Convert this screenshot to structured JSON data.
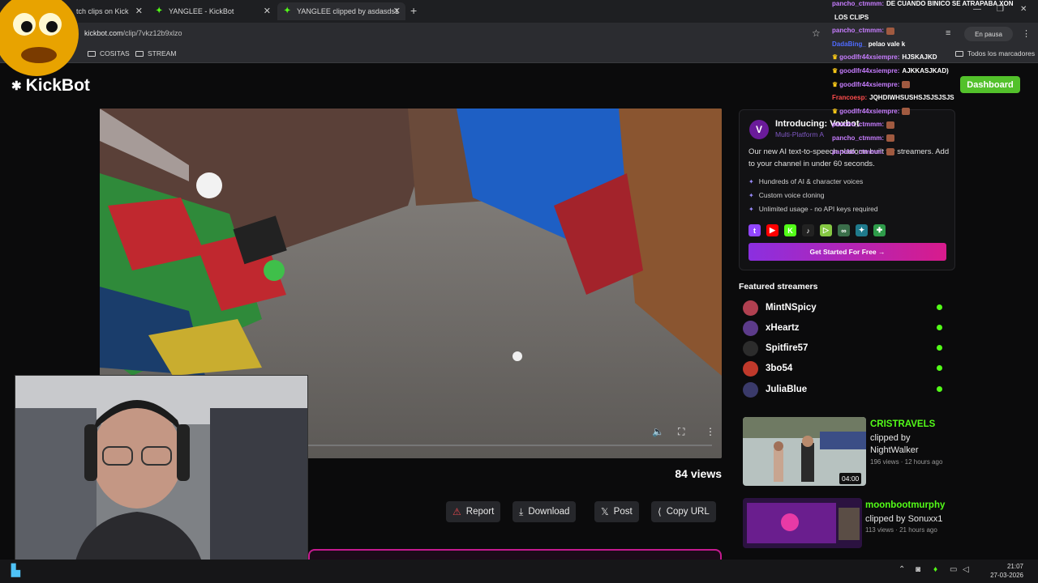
{
  "browser": {
    "tabs": [
      {
        "label": "tch clips on Kick"
      },
      {
        "label": "YANGLEE - KickBot"
      },
      {
        "label": "YANGLEE clipped by asdasds1"
      }
    ],
    "new_tab": "+",
    "url_host": "kickbot.com",
    "url_path": "/clip/7vkz12b9xlzo",
    "bookmarks": [
      "COSITAS",
      "STREAM"
    ],
    "bookmarks_right": "Todos los marcadores",
    "pause_label": "En pausa"
  },
  "header": {
    "logo_text": "KickBot",
    "dashboard_label": "Dashboard"
  },
  "clip": {
    "views": "84 views",
    "actions": {
      "report": "Report",
      "download": "Download",
      "post": "Post",
      "copy_url": "Copy URL"
    }
  },
  "ad": {
    "logo_letter": "V",
    "title": "Introducing: Voxbot",
    "subtitle": "Multi-Platform A",
    "description": "Our new AI text-to-speech platform built for streamers. Add to your channel in under 60 seconds.",
    "features": [
      "Hundreds of AI & character voices",
      "Custom voice cloning",
      "Unlimited usage - no API keys required"
    ],
    "platforms": [
      {
        "name": "twitch-icon",
        "glyph": "t",
        "color": "#9146ff"
      },
      {
        "name": "youtube-icon",
        "glyph": "▶",
        "color": "#ff0000"
      },
      {
        "name": "kick-icon",
        "glyph": "K",
        "color": "#53fc18"
      },
      {
        "name": "tiktok-icon",
        "glyph": "♪",
        "color": "#222222"
      },
      {
        "name": "rumble-icon",
        "glyph": "▷",
        "color": "#85c742"
      },
      {
        "name": "link-icon",
        "glyph": "∞",
        "color": "#3a6e4a"
      },
      {
        "name": "streamelements-icon",
        "glyph": "✦",
        "color": "#1f7a8c"
      },
      {
        "name": "puzzle-icon",
        "glyph": "✚",
        "color": "#2e9b4a"
      }
    ],
    "cta": "Get Started For Free →"
  },
  "featured": {
    "title": "Featured streamers",
    "streamers": [
      {
        "name": "MintNSpicy",
        "avatar_color": "#b04050"
      },
      {
        "name": "xHeartz",
        "avatar_color": "#5c3b8a"
      },
      {
        "name": "Spitfire57",
        "avatar_color": "#2c2c2c"
      },
      {
        "name": "3bo54",
        "avatar_color": "#c0392b"
      },
      {
        "name": "JuliaBlue",
        "avatar_color": "#3a3a6a"
      }
    ]
  },
  "clips": [
    {
      "channel": "CRISTRAVELS",
      "by": "clipped by NightWalker",
      "meta": "196 views · 12 hours ago",
      "duration": "04:00"
    },
    {
      "channel": "moonbootmurphy",
      "by": "clipped by Sonuxx1",
      "meta": "113 views · 21 hours ago",
      "duration": ""
    }
  ],
  "chat": [
    {
      "user": "pancho_ctmmm:",
      "user_color": "#c77dff",
      "msg": "DE CUANDO BINICO SE ATRAPABA XON",
      "crown": false,
      "emote": false
    },
    {
      "user": "",
      "user_color": "#ffffff",
      "msg": "LOS CLIPS",
      "crown": false,
      "emote": false
    },
    {
      "user": "pancho_ctmmm:",
      "user_color": "#c77dff",
      "msg": "",
      "crown": false,
      "emote": true
    },
    {
      "user": "DadaBing_",
      "user_color": "#4f6bff",
      "msg": "pelao vale k",
      "crown": false,
      "emote": false
    },
    {
      "user": "goodlfr44xsiempre:",
      "user_color": "#c77dff",
      "msg": "HJSKAJKD",
      "crown": true,
      "emote": false
    },
    {
      "user": "goodlfr44xsiempre:",
      "user_color": "#c77dff",
      "msg": "AJKKASJKAD)",
      "crown": true,
      "emote": false
    },
    {
      "user": "goodlfr44xsiempre:",
      "user_color": "#c77dff",
      "msg": "",
      "crown": true,
      "emote": true
    },
    {
      "user": "Francoesp:",
      "user_color": "#ff4d4d",
      "msg": "JQHDIWHSUSHSJSJSJSJS",
      "crown": false,
      "emote": false
    },
    {
      "user": "goodlfr44xsiempre:",
      "user_color": "#c77dff",
      "msg": "",
      "crown": true,
      "emote": true
    },
    {
      "user": "pancho_ctmmm:",
      "user_color": "#c77dff",
      "msg": "",
      "crown": false,
      "emote": true
    },
    {
      "user": "pancho_ctmmm:",
      "user_color": "#c77dff",
      "msg": "",
      "crown": false,
      "emote": true
    },
    {
      "user": "pancho_ctmmm:",
      "user_color": "#c77dff",
      "msg": "",
      "crown": false,
      "emote": true
    }
  ],
  "taskbar": {
    "time": "21:07",
    "date": "27-03-2026"
  }
}
